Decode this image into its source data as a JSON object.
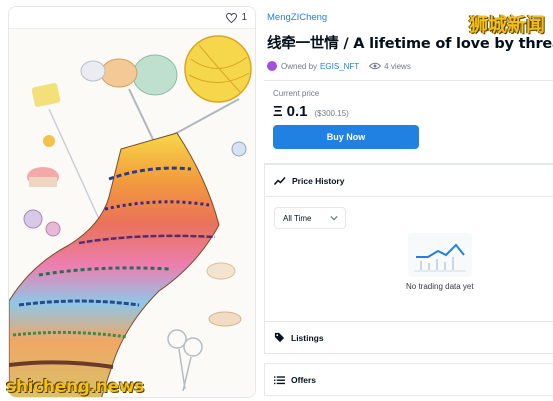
{
  "asset": {
    "favorite_count": "1",
    "collection": "MengZICheng",
    "title": "线牵一世情 / A lifetime of love by thread",
    "owned_by_label": "Owned by",
    "owner": "EGIS_NFT",
    "views": "4 views"
  },
  "price": {
    "label": "Current price",
    "symbol": "Ξ",
    "value": "0.1",
    "usd": "($300.15)",
    "buy_label": "Buy Now"
  },
  "price_history": {
    "title": "Price History",
    "period": "All Time",
    "empty_text": "No trading data yet"
  },
  "listings": {
    "title": "Listings"
  },
  "offers": {
    "title": "Offers"
  },
  "watermark": {
    "top": "狮城新闻",
    "bottom": "shicheng.news"
  },
  "colors": {
    "accent": "#2081e2",
    "owner_avatar": "#a34fde",
    "watermark": "#f2c01a"
  },
  "icons": [
    "heart-icon",
    "eye-icon",
    "trend-line-icon",
    "chevron-down-icon",
    "tag-icon",
    "list-icon"
  ]
}
